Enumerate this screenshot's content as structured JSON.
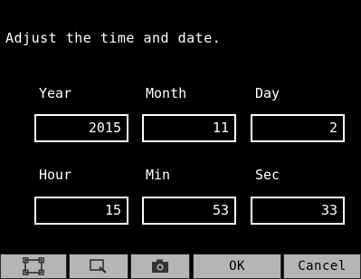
{
  "prompt": "Adjust the time and date.",
  "fields": {
    "year": {
      "label": "Year",
      "value": "2015"
    },
    "month": {
      "label": "Month",
      "value": "11"
    },
    "day": {
      "label": "Day",
      "value": "2"
    },
    "hour": {
      "label": "Hour",
      "value": "15"
    },
    "min": {
      "label": "Min",
      "value": "53"
    },
    "sec": {
      "label": "Sec",
      "value": "33"
    }
  },
  "toolbar": {
    "icons": [
      "frame-icon",
      "zoom-icon",
      "camera-icon"
    ],
    "ok_label": "OK",
    "cancel_label": "Cancel"
  },
  "colors": {
    "background": "#000000",
    "text": "#ffffff",
    "toolbar_button": "#b5b5b5"
  }
}
